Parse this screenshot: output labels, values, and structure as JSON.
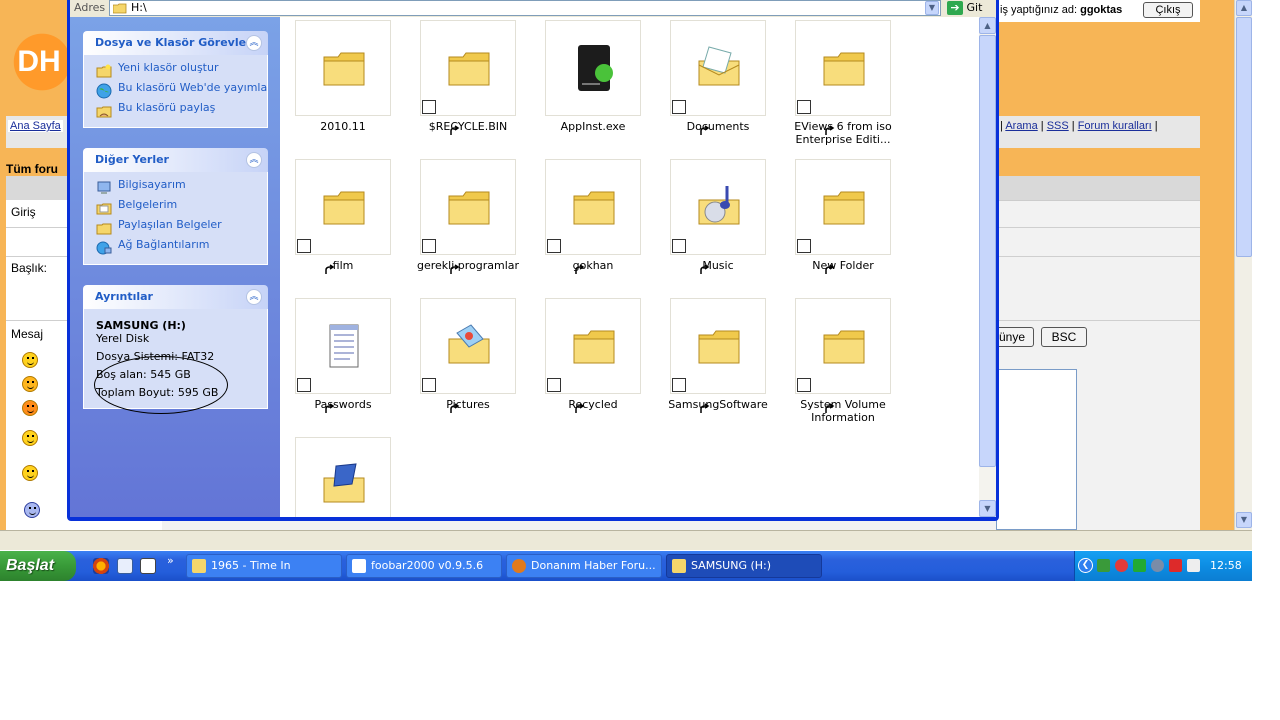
{
  "browser": {
    "logged_in_prefix": "iş yaptığınız ad:",
    "logged_in_user": "ggoktas",
    "logout_label": "Çıkış",
    "nav_home": "Ana Sayfa",
    "nav_search": "Arama",
    "nav_faq": "SSS",
    "nav_rules": "Forum kuralları",
    "all_forums": "Tüm foru",
    "form_login": "Giriş",
    "form_title": "Başlık:",
    "form_message": "Mesaj",
    "format_btn_1": "ünye",
    "format_btn_2": "BSC"
  },
  "explorer": {
    "address_label": "Adres",
    "address_value": "H:\\",
    "go_label": "Git",
    "tasks_panel": {
      "title": "Dosya ve Klasör Görevleri",
      "items": [
        {
          "label": "Yeni klasör oluştur",
          "icon": "new-folder-icon"
        },
        {
          "label": "Bu klasörü Web'de yayımla",
          "icon": "globe-icon"
        },
        {
          "label": "Bu klasörü paylaş",
          "icon": "share-folder-icon"
        }
      ]
    },
    "places_panel": {
      "title": "Diğer Yerler",
      "items": [
        {
          "label": "Bilgisayarım",
          "icon": "computer-icon"
        },
        {
          "label": "Belgelerim",
          "icon": "documents-icon"
        },
        {
          "label": "Paylaşılan Belgeler",
          "icon": "shared-folder-icon"
        },
        {
          "label": "Ağ Bağlantılarım",
          "icon": "network-icon"
        }
      ]
    },
    "details_panel": {
      "title": "Ayrıntılar",
      "drive_name": "SAMSUNG (H:)",
      "drive_type": "Yerel Disk",
      "file_system": "Dosya Sistemi: FAT32",
      "free_space": "Boş alan: 545 GB",
      "total_size": "Toplam Boyut: 595 GB"
    },
    "files": [
      {
        "name": "2010.11",
        "kind": "folder",
        "shortcut": false
      },
      {
        "name": "$RECYCLE.BIN",
        "kind": "folder",
        "shortcut": true
      },
      {
        "name": "AppInst.exe",
        "kind": "exe",
        "shortcut": false
      },
      {
        "name": "Documents",
        "kind": "docs-folder",
        "shortcut": true
      },
      {
        "name": "EViews 6 from iso Enterprise Editi...",
        "kind": "folder",
        "shortcut": true
      },
      {
        "name": "film",
        "kind": "folder",
        "shortcut": true
      },
      {
        "name": "gerekli programlar",
        "kind": "folder",
        "shortcut": true
      },
      {
        "name": "gokhan",
        "kind": "folder",
        "shortcut": true
      },
      {
        "name": "Music",
        "kind": "music-folder",
        "shortcut": true
      },
      {
        "name": "New Folder",
        "kind": "folder",
        "shortcut": true
      },
      {
        "name": "Passwords",
        "kind": "notepad",
        "shortcut": true
      },
      {
        "name": "Pictures",
        "kind": "pictures-folder",
        "shortcut": true
      },
      {
        "name": "Recycled",
        "kind": "folder",
        "shortcut": true
      },
      {
        "name": "SamsungSoftware",
        "kind": "folder",
        "shortcut": true
      },
      {
        "name": "System Volume Information",
        "kind": "folder",
        "shortcut": true
      },
      {
        "name": "",
        "kind": "video-folder",
        "shortcut": true
      }
    ]
  },
  "taskbar": {
    "start_label": "Başlat",
    "buttons": [
      {
        "label": "1965 - Time In",
        "icon": "folder-icon",
        "active": false
      },
      {
        "label": "foobar2000 v0.9.5.6",
        "icon": "foobar-icon",
        "active": false
      },
      {
        "label": "Donanım Haber Foru...",
        "icon": "firefox-icon",
        "active": false
      },
      {
        "label": "SAMSUNG (H:)",
        "icon": "folder-icon",
        "active": true
      }
    ],
    "clock": "12:58"
  },
  "colors": {
    "xp_blue": "#0831d9",
    "taskbar_blue": "#245edb",
    "start_green": "#389a38",
    "folder_yellow": "#f5d66b",
    "forum_orange": "#f7b556",
    "link_blue": "#215dc6"
  }
}
